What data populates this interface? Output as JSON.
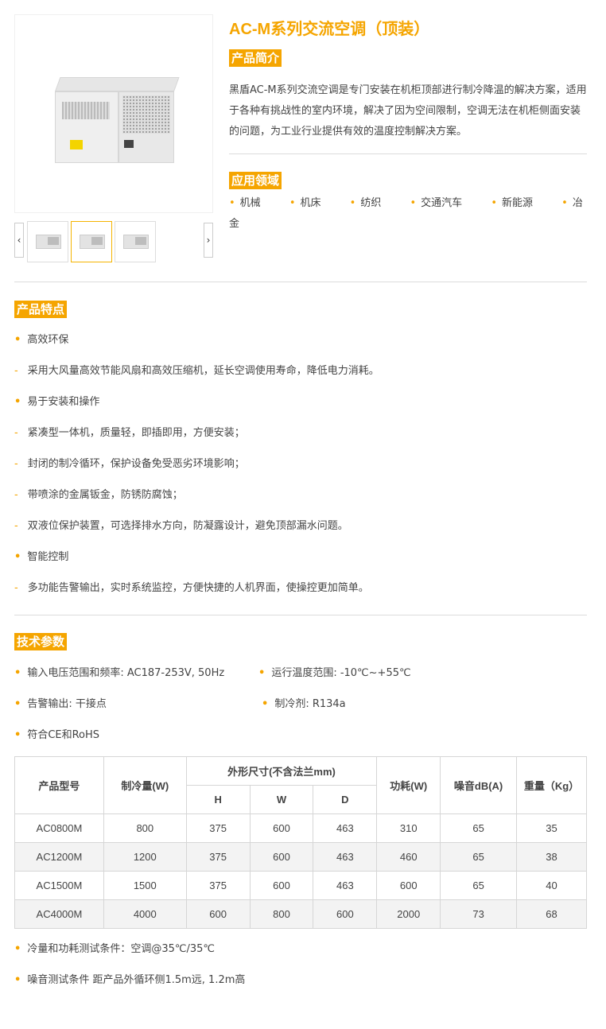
{
  "product": {
    "title": "AC-M系列交流空调（顶装）",
    "intro_tag": "产品简介",
    "intro_text": "黑盾AC-M系列交流空调是专门安装在机柜顶部进行制冷降温的解决方案，适用于各种有挑战性的室内环境，解决了因为空间限制，空调无法在机柜侧面安装的问题，为工业行业提供有效的温度控制解决方案。",
    "apps_tag": "应用领域",
    "apps": [
      "机械",
      "机床",
      "纺织",
      "交通汽车",
      "新能源",
      "冶金"
    ]
  },
  "gallery": {
    "prev": "‹",
    "next": "›",
    "active_thumb": 1
  },
  "features": {
    "tag": "产品特点",
    "groups": [
      {
        "title": "高效环保",
        "items": [
          "采用大风量高效节能风扇和高效压缩机，延长空调使用寿命，降低电力消耗。"
        ]
      },
      {
        "title": "易于安装和操作",
        "items": [
          "紧凑型一体机，质量轻，即插即用，方便安装；",
          "封闭的制冷循环，保护设备免受恶劣环境影响；",
          "带喷涂的金属钣金，防锈防腐蚀；",
          "双液位保护装置，可选择排水方向，防凝露设计，避免顶部漏水问题。"
        ]
      },
      {
        "title": "智能控制",
        "items": [
          "多功能告警输出，实时系统监控，方便快捷的人机界面，使操控更加简单。"
        ]
      }
    ]
  },
  "specs": {
    "tag": "技术参数",
    "voltage": "输入电压范围和频率: AC187-253V, 50Hz",
    "temp": "运行温度范围: -10℃~+55℃",
    "alarm": "告警输出: 干接点",
    "refrigerant": "制冷剂: R134a",
    "cert": "符合CE和RoHS",
    "table": {
      "headers": {
        "model": "产品型号",
        "cooling": "制冷量(W)",
        "dims": "外形尺寸(不含法兰mm)",
        "h": "H",
        "w": "W",
        "d": "D",
        "power": "功耗(W)",
        "noise": "噪音dB(A)",
        "weight": "重量（Kg）"
      },
      "rows": [
        [
          "AC0800M",
          "800",
          "375",
          "600",
          "463",
          "310",
          "65",
          "35"
        ],
        [
          "AC1200M",
          "1200",
          "375",
          "600",
          "463",
          "460",
          "65",
          "38"
        ],
        [
          "AC1500M",
          "1500",
          "375",
          "600",
          "463",
          "600",
          "65",
          "40"
        ],
        [
          "AC4000M",
          "4000",
          "600",
          "800",
          "600",
          "2000",
          "73",
          "68"
        ]
      ]
    },
    "note1": "冷量和功耗测试条件：空调@35℃/35℃",
    "note2": "噪音测试条件 距产品外循环侧1.5m远, 1.2m高"
  },
  "icons": {
    "bullet": "•",
    "dash": "-"
  },
  "colors": {
    "accent": "#f5a500",
    "border": "#d6d6d6"
  }
}
